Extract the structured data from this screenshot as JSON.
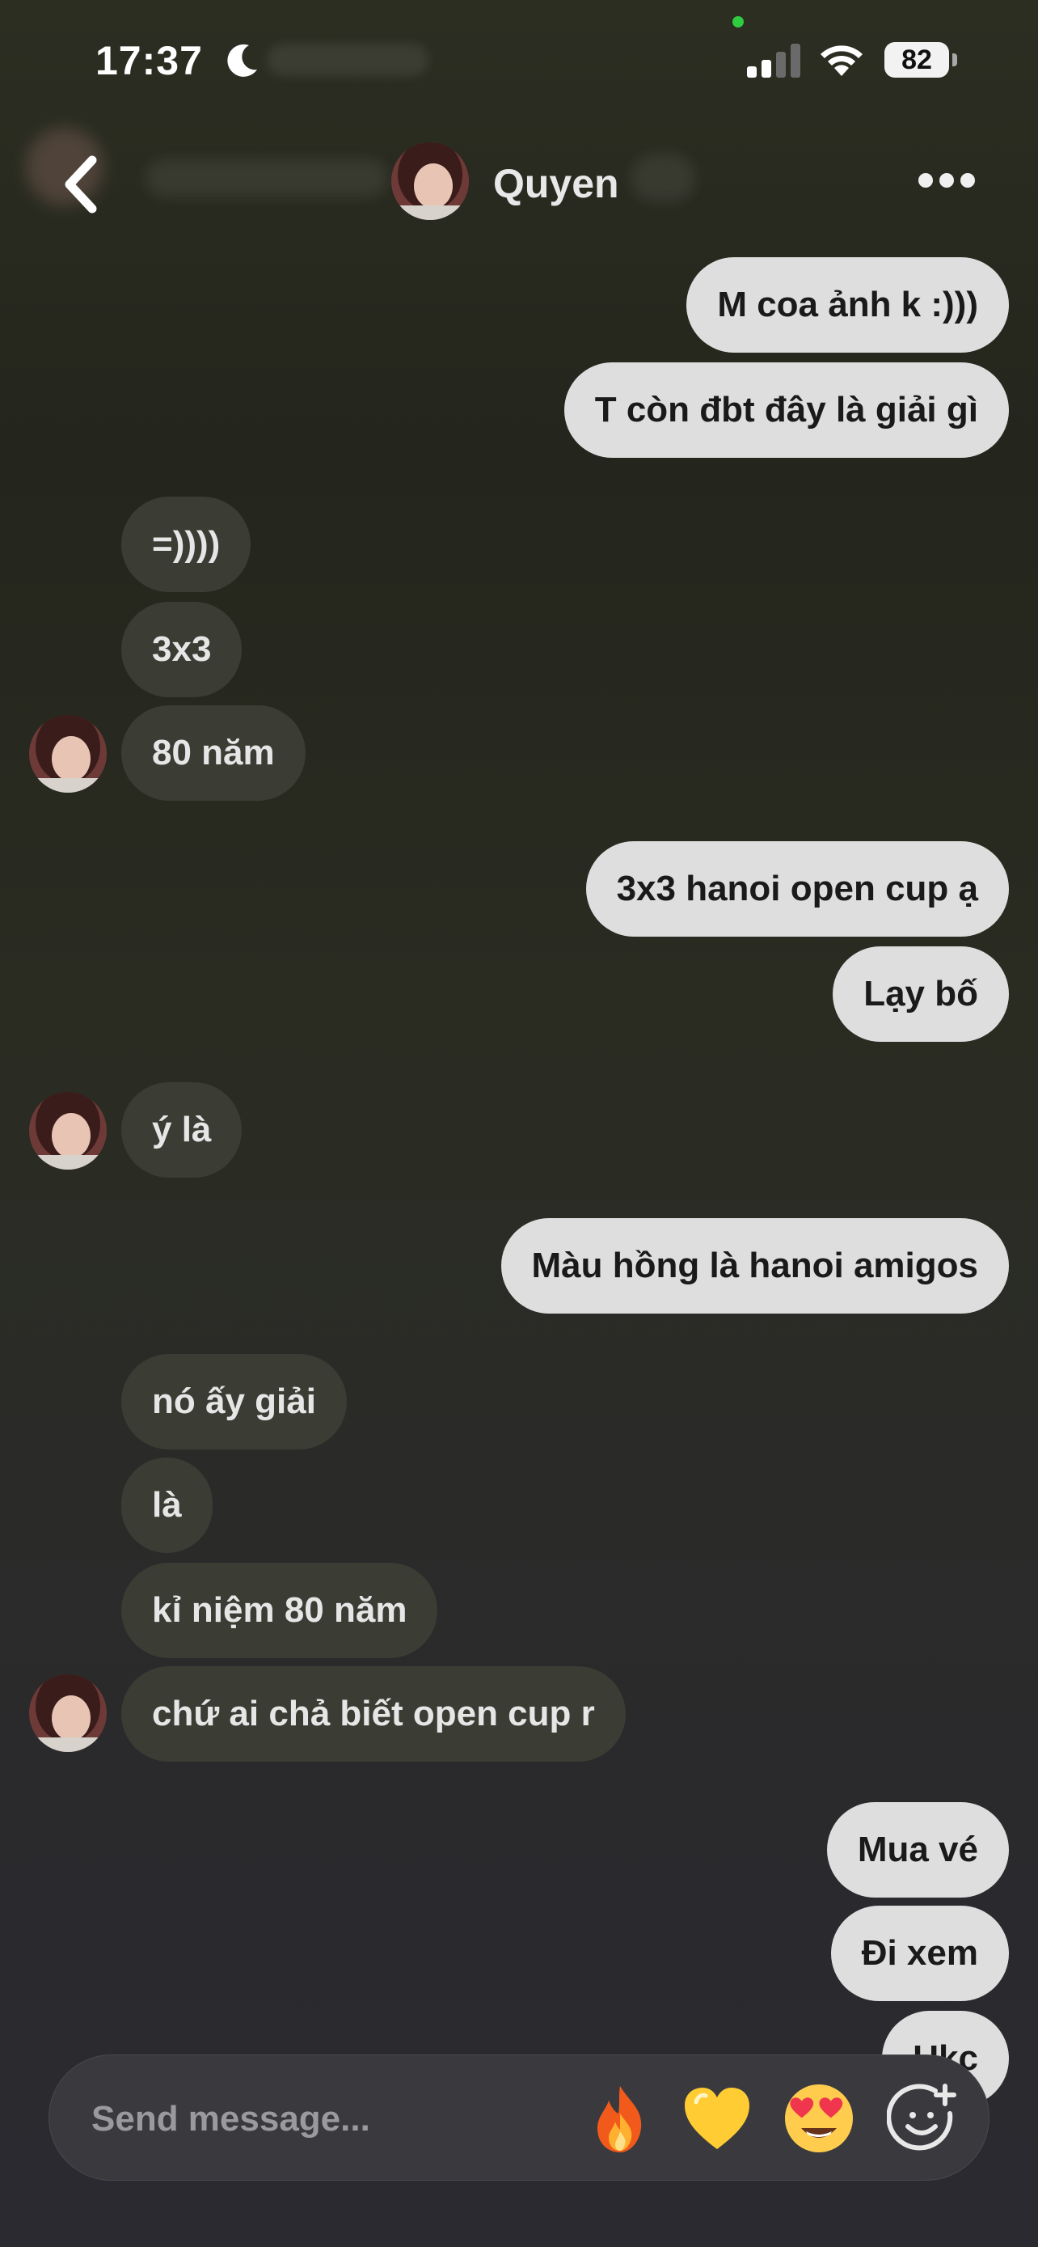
{
  "status_bar": {
    "time": "17:37",
    "battery": "82",
    "moon_icon": "moon-icon",
    "signal_icon": "cellular-signal-icon",
    "wifi_icon": "wifi-icon"
  },
  "header": {
    "contact_name": "Quyen",
    "back_icon": "chevron-left-icon",
    "more_icon": "more-horizontal-icon"
  },
  "messages": [
    {
      "side": "out",
      "text": "M coa ảnh k :)))"
    },
    {
      "side": "out",
      "text": "T còn đbt đây là giải gì"
    },
    {
      "side": "in",
      "text": "=))))"
    },
    {
      "side": "in",
      "text": "3x3"
    },
    {
      "side": "in",
      "text": "80 năm"
    },
    {
      "side": "out",
      "text": "3x3 hanoi open cup ạ"
    },
    {
      "side": "out",
      "text": "Lạy bố"
    },
    {
      "side": "in",
      "text": "ý là"
    },
    {
      "side": "out",
      "text": "Màu hồng là hanoi amigos"
    },
    {
      "side": "in",
      "text": "nó ấy giải"
    },
    {
      "side": "in",
      "text": "là"
    },
    {
      "side": "in",
      "text": "kỉ niệm 80 năm"
    },
    {
      "side": "in",
      "text": "chứ ai chả biết open cup r"
    },
    {
      "side": "out",
      "text": "Mua vé"
    },
    {
      "side": "out",
      "text": "Đi xem"
    },
    {
      "side": "out",
      "text": "Ukc"
    }
  ],
  "composer": {
    "placeholder": "Send message...",
    "quick_reactions": [
      "fire-emoji",
      "yellow-heart-emoji",
      "heart-eyes-emoji"
    ],
    "sticker_icon": "add-sticker-icon"
  },
  "colors": {
    "outgoing_bubble": "#dedede",
    "incoming_bubble": "#3b3c34",
    "composer_bg": "#3a3a3e"
  }
}
